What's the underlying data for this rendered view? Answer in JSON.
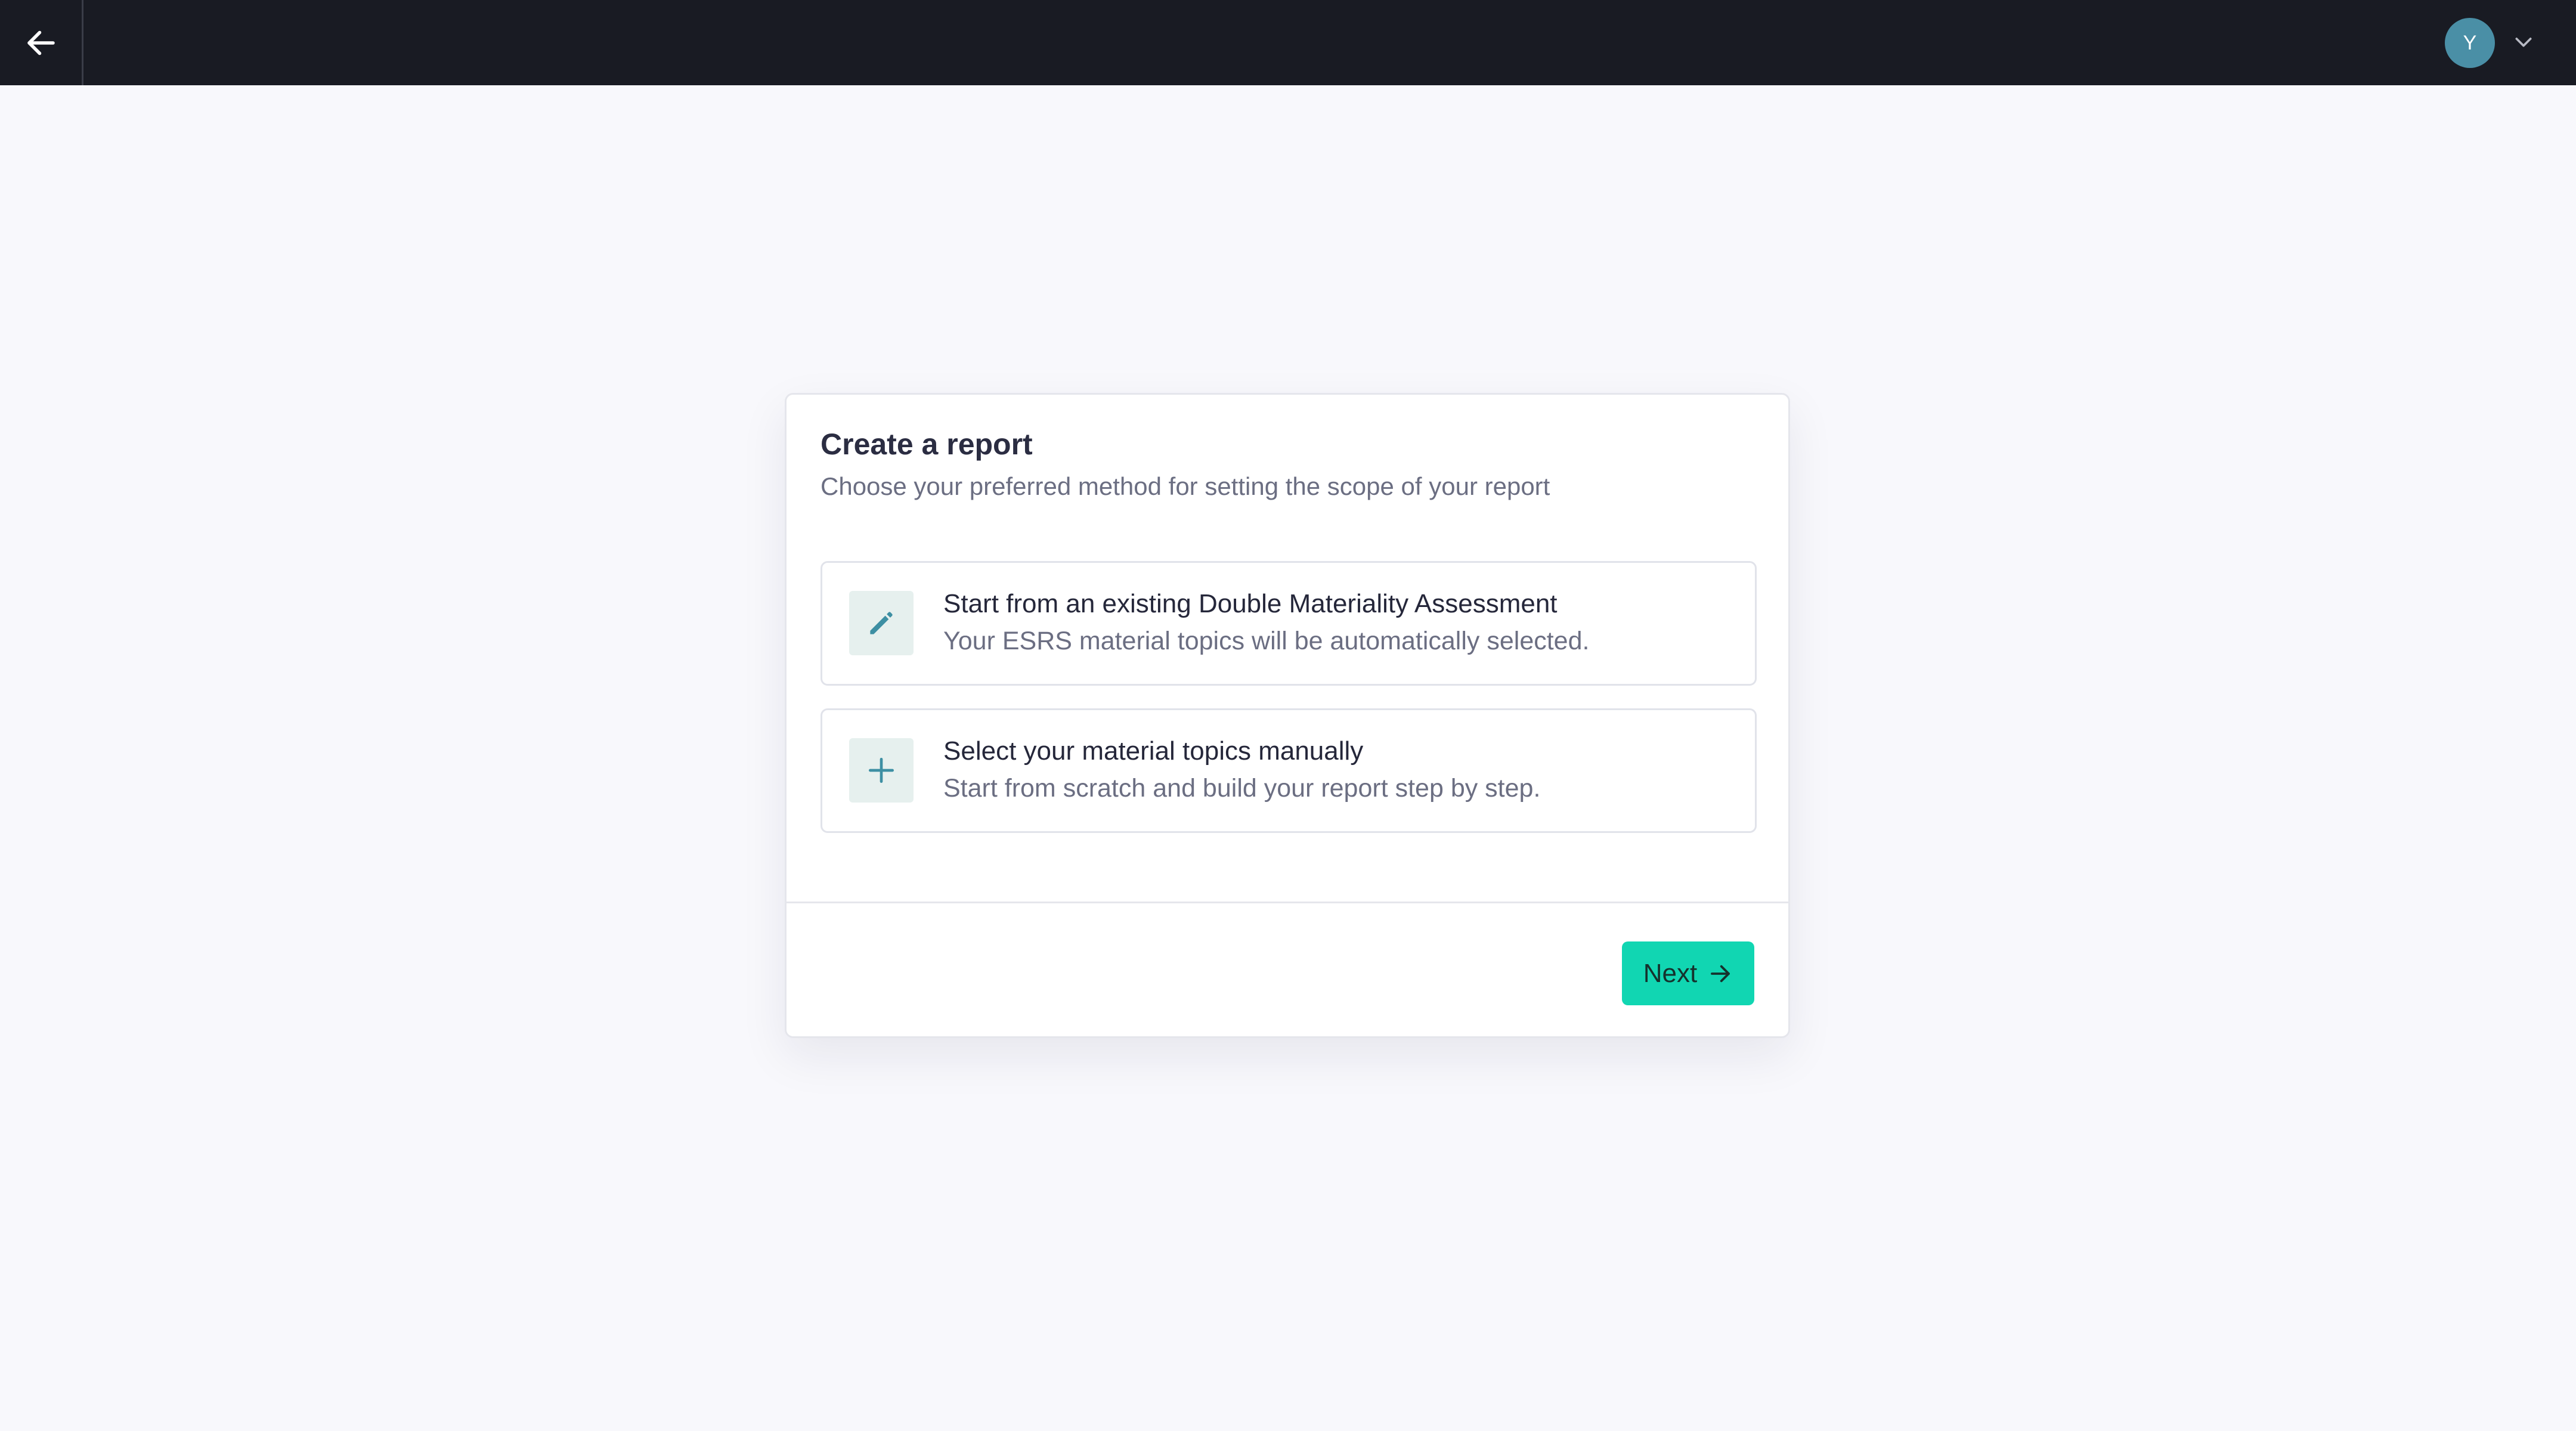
{
  "topbar": {
    "back_icon": "arrow-left-icon",
    "user": {
      "avatar_initial": "Y",
      "avatar_color": "#4a8fa6",
      "menu_icon": "chevron-down-icon"
    }
  },
  "dialog": {
    "title": "Create a report",
    "subtitle": "Choose your preferred method for setting the scope of your report",
    "options": [
      {
        "icon": "pencil-icon",
        "title": "Start from an existing Double Materiality Assessment",
        "description": "Your ESRS material topics will be automatically selected."
      },
      {
        "icon": "plus-icon",
        "title": "Select your material topics manually",
        "description": "Start from scratch and build your report step by step."
      }
    ],
    "next_label": "Next",
    "next_icon": "arrow-right-icon",
    "accent_color": "#11d6b2"
  }
}
